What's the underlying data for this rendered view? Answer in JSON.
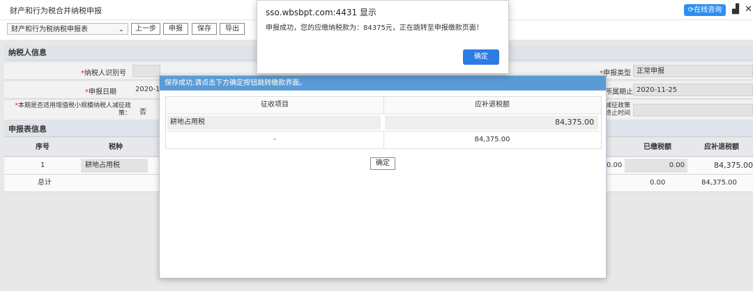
{
  "app": {
    "title": "财产和行为税合并纳税申报",
    "consult_button": "在线咨询"
  },
  "toolbar": {
    "form_select": "财产和行为税纳税申报表",
    "buttons": [
      "上一步",
      "申报",
      "保存",
      "导出"
    ]
  },
  "taxpayer": {
    "section_title": "纳税人信息",
    "id_label": "纳税人识别号",
    "declare_date_label": "申报日期",
    "declare_date_value": "2020-1",
    "small_scale_label": "本期是否适用增值税小规模纳税人减征政策：",
    "small_scale_value": "否",
    "declare_type_label": "申报类型",
    "declare_type_value": "正常申报",
    "period_end_label": "所属期止",
    "period_end_value": "2020-11-25",
    "policy_end_label": "减征政策终止时间",
    "policy_end_value": ""
  },
  "report": {
    "section_title": "申报表信息",
    "headers": [
      "序号",
      "税种",
      "已缴税额",
      "应补退税额"
    ],
    "rows": [
      {
        "index": "1",
        "tax_type": "耕地占用税",
        "paid_left": "0.00",
        "paid": "0.00",
        "due": "84,375.00"
      }
    ],
    "total": {
      "label": "总计",
      "paid": "0.00",
      "due": "84,375.00"
    }
  },
  "modal": {
    "header": "保存成功,请点击下方确定按钮跳转缴款界面。",
    "columns": [
      "征收项目",
      "应补退税额"
    ],
    "rows": [
      {
        "item": "耕地占用税",
        "amount": "84,375.00"
      },
      {
        "item": "-",
        "amount": "84,375.00"
      }
    ],
    "confirm": "确定"
  },
  "alert": {
    "origin": "sso.wbsbpt.com:4431 显示",
    "message": "申报成功，您的应缴纳税款为：84375元，正在跳转至申报缴款页面！",
    "ok": "确定"
  }
}
